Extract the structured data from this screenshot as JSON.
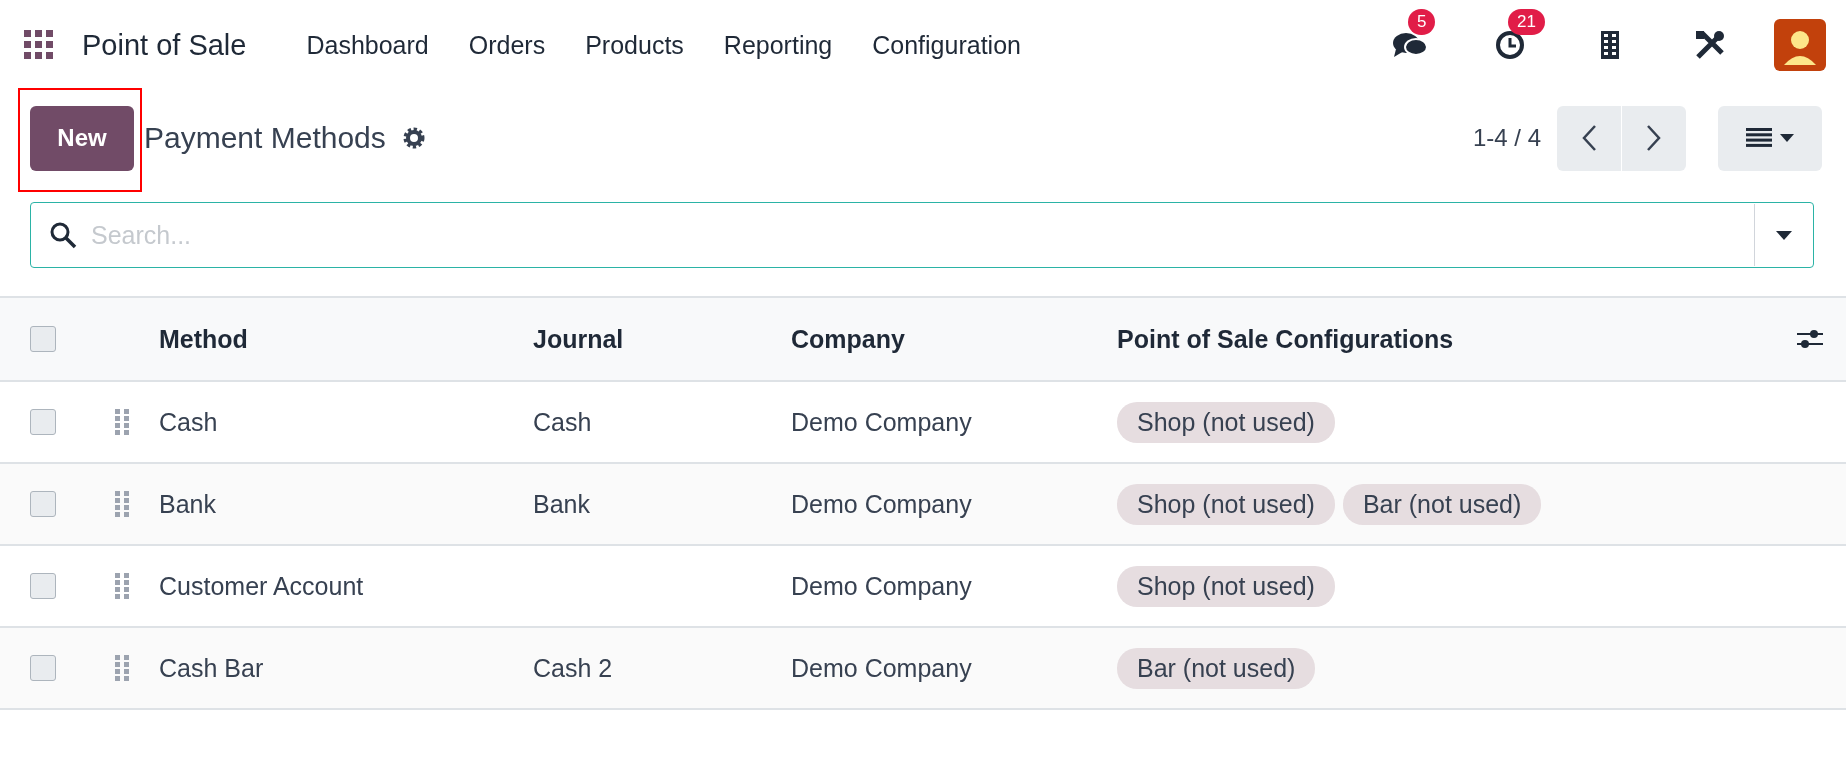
{
  "navbar": {
    "app_name": "Point of Sale",
    "menu": [
      "Dashboard",
      "Orders",
      "Products",
      "Reporting",
      "Configuration"
    ],
    "messages_count": "5",
    "activities_count": "21"
  },
  "control_panel": {
    "new_button": "New",
    "title": "Payment Methods",
    "pager": "1-4 / 4",
    "highlighted": true
  },
  "search": {
    "placeholder": "Search..."
  },
  "table": {
    "columns": [
      "Method",
      "Journal",
      "Company",
      "Point of Sale Configurations"
    ],
    "header_checked": false,
    "rows": [
      {
        "checked": false,
        "method": "Cash",
        "journal": "Cash",
        "company": "Demo Company",
        "configs": [
          "Shop (not used)"
        ]
      },
      {
        "checked": false,
        "method": "Bank",
        "journal": "Bank",
        "company": "Demo Company",
        "configs": [
          "Shop (not used)",
          "Bar (not used)"
        ]
      },
      {
        "checked": false,
        "method": "Customer Account",
        "journal": "",
        "company": "Demo Company",
        "configs": [
          "Shop (not used)"
        ]
      },
      {
        "checked": false,
        "method": "Cash Bar",
        "journal": "Cash 2",
        "company": "Demo Company",
        "configs": [
          "Bar (not used)"
        ]
      }
    ]
  }
}
